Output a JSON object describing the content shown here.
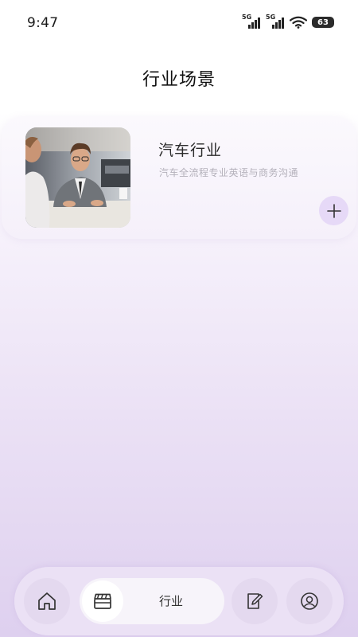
{
  "status_bar": {
    "time": "9:47",
    "network_1": "5G",
    "network_2": "5G",
    "battery": "63",
    "icons": [
      "signal-icon",
      "signal-icon",
      "wifi-icon",
      "battery-icon"
    ]
  },
  "page": {
    "title": "行业场景"
  },
  "cards": [
    {
      "title": "汽车行业",
      "description": "汽车全流程专业英语与商务沟通",
      "image": "business-meeting-photo",
      "add_icon": "plus-icon"
    }
  ],
  "tabbar": {
    "items": [
      {
        "icon": "home-icon",
        "active": false
      },
      {
        "icon": "clapperboard-icon",
        "label": "行业",
        "active": true
      },
      {
        "icon": "edit-icon",
        "active": false
      },
      {
        "icon": "user-icon",
        "active": false
      }
    ]
  },
  "colors": {
    "accent": "#e6d9f7",
    "background_top": "#ffffff",
    "background_bottom": "#ded0ef"
  }
}
